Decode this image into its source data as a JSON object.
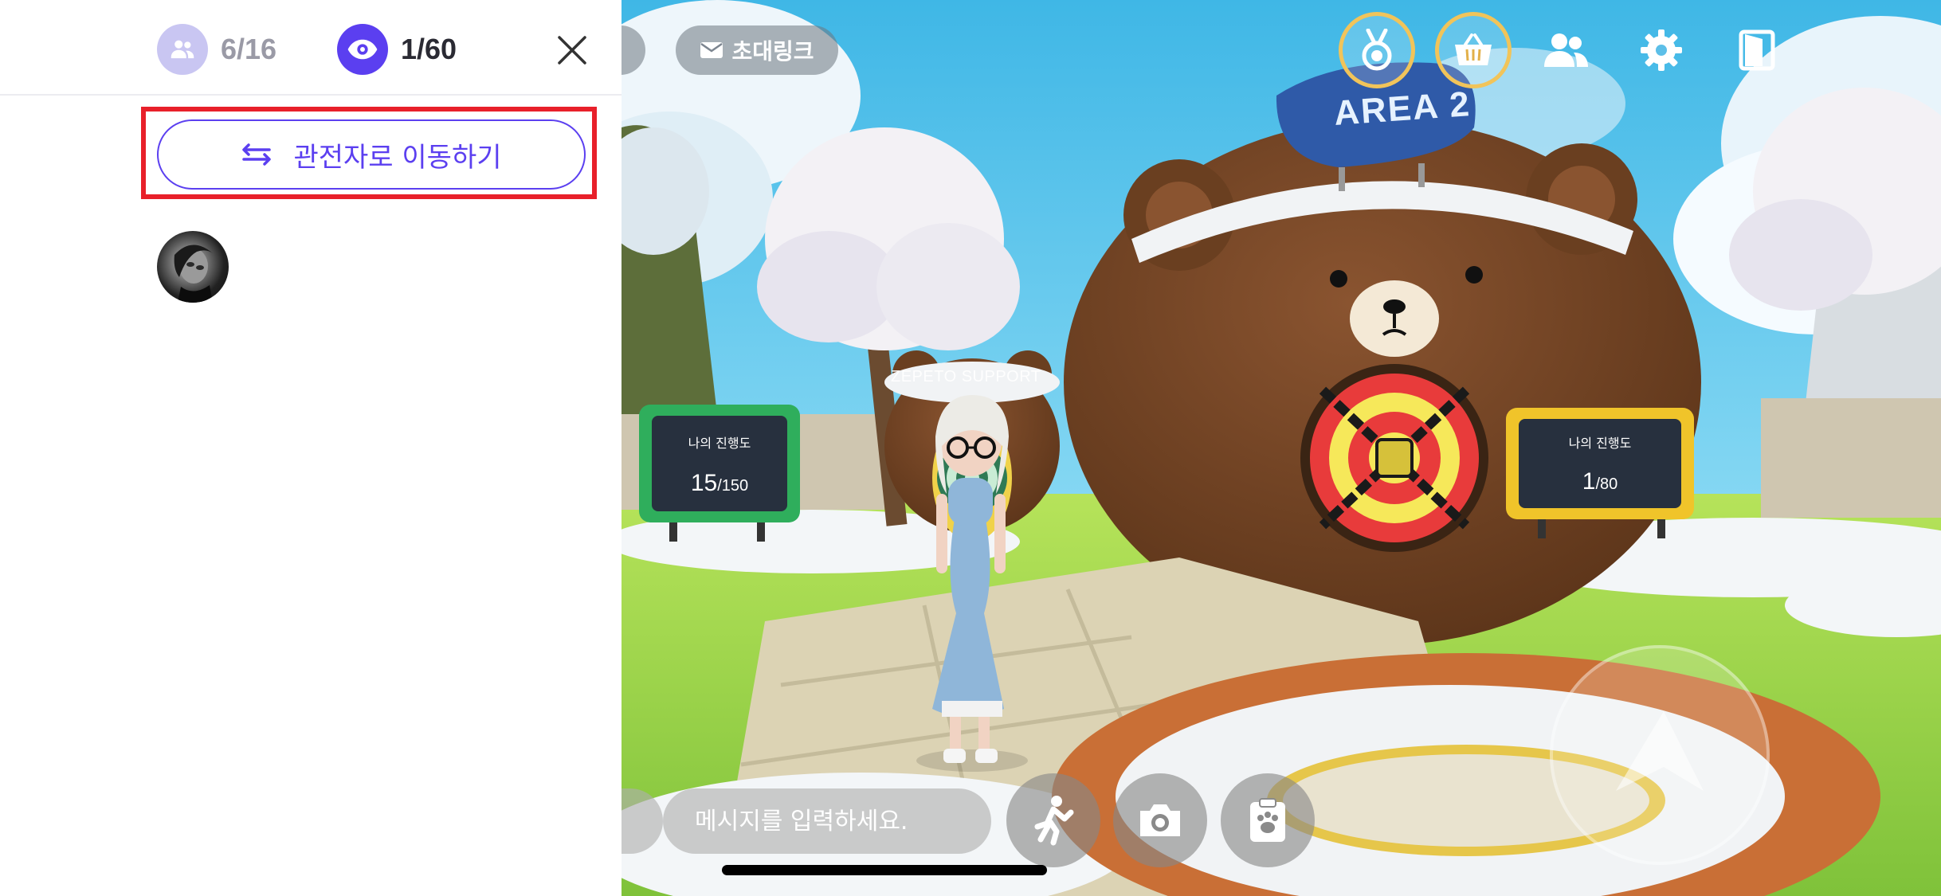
{
  "panel": {
    "players": {
      "icon": "people-icon",
      "count_text": "6/16"
    },
    "spectators": {
      "icon": "eye-icon",
      "count_text": "1/60"
    },
    "close_icon": "close-icon",
    "move_button": {
      "icon": "swap-arrows-icon",
      "label": "관전자로 이동하기"
    },
    "spectator_list": [
      {
        "avatar": "avatar"
      }
    ]
  },
  "hud": {
    "invite_button": {
      "icon": "mail-icon",
      "label": "초대링크"
    },
    "top_icons": [
      "medal-icon",
      "shop-basket-icon",
      "friends-icon",
      "gear-icon",
      "exit-door-icon"
    ]
  },
  "scene": {
    "area_sign": "AREA 2",
    "player_name": "ZEPETO SUPPORT",
    "left_board": {
      "title": "나의 진행도",
      "value": "15",
      "total": "/150"
    },
    "right_board": {
      "title": "나의 진행도",
      "value": "1",
      "total": "/80"
    }
  },
  "bottom_bar": {
    "message_placeholder": "메시지를 입력하세요.",
    "buttons": [
      "gesture-icon",
      "camera-icon",
      "pet-paw-icon",
      "jump-arrow-icon"
    ]
  },
  "colors": {
    "accent": "#5b3ff0",
    "player_badge": "#c9c6f2",
    "highlight_frame": "#e8202a",
    "ring_gold": "#f1c45a",
    "sky": "#5dc6ea",
    "grass": "#9ed94a"
  }
}
